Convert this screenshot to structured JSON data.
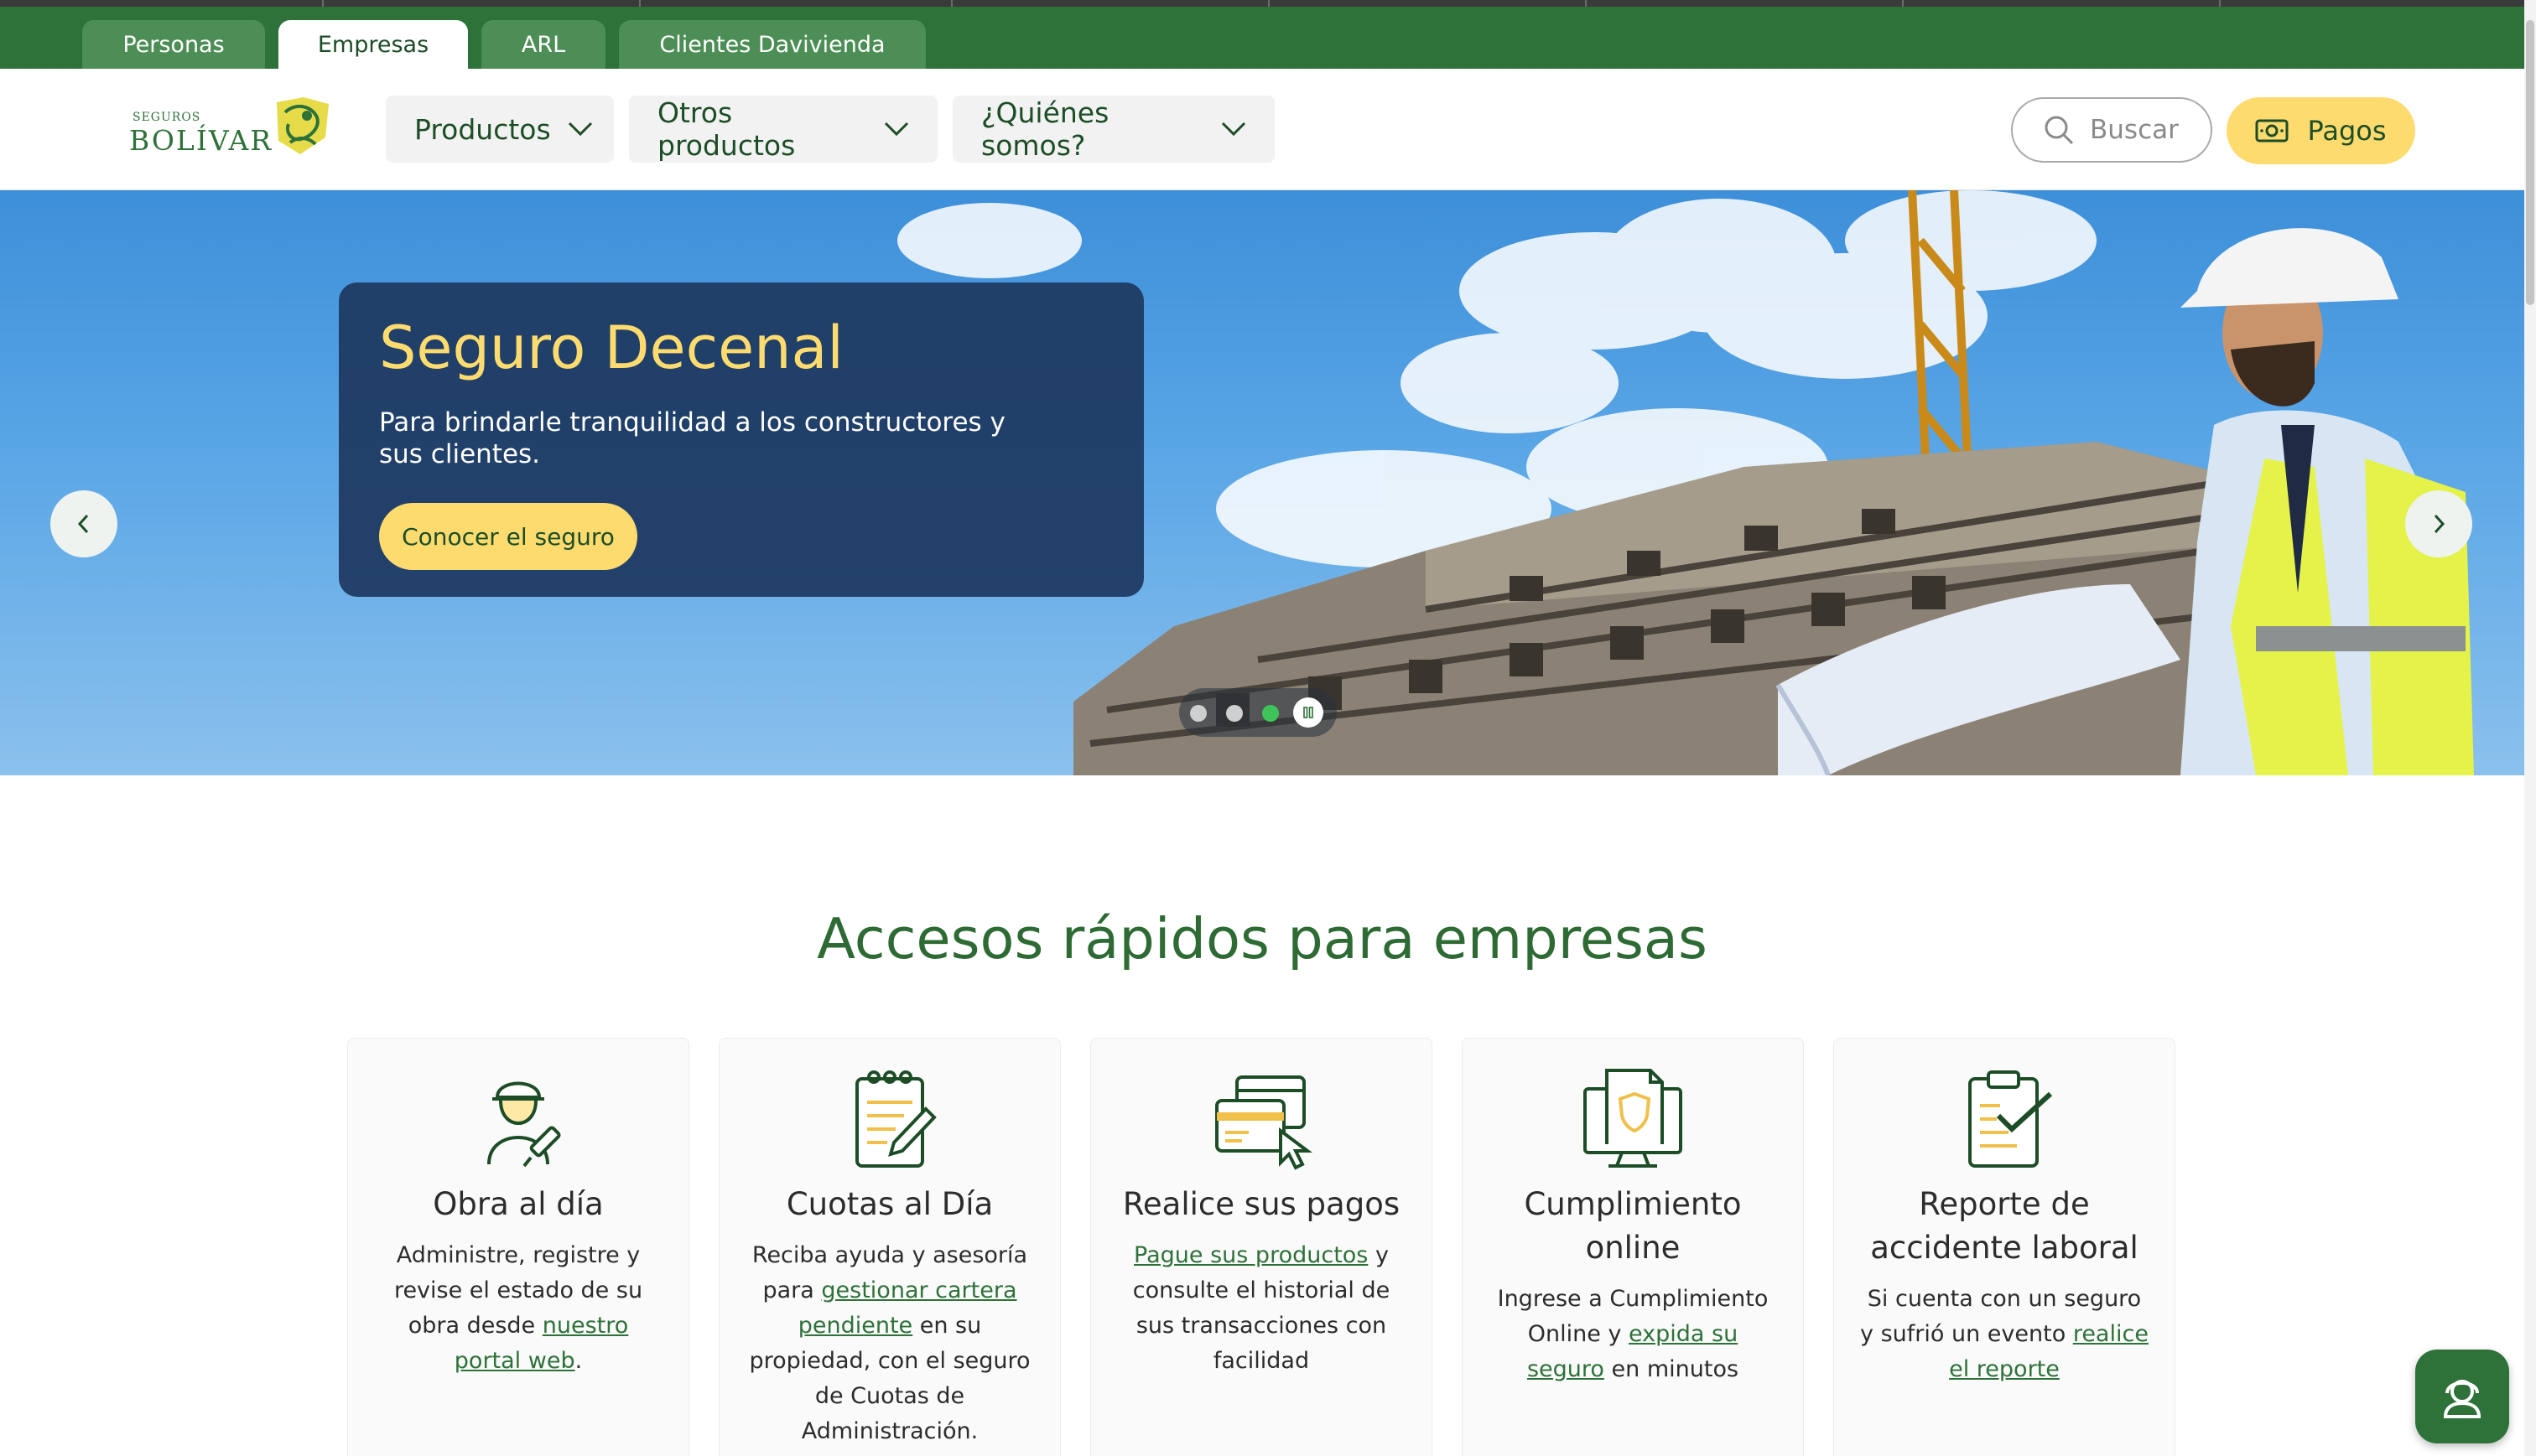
{
  "segments": {
    "tabs": [
      {
        "label": "Personas",
        "active": false
      },
      {
        "label": "Empresas",
        "active": true
      },
      {
        "label": "ARL",
        "active": false
      },
      {
        "label": "Clientes Davivienda",
        "active": false
      }
    ]
  },
  "header": {
    "logo": {
      "small_text": "SEGUROS",
      "big_text": "BOLÍVAR"
    },
    "nav": [
      {
        "label": "Productos"
      },
      {
        "label": "Otros productos"
      },
      {
        "label": "¿Quiénes somos?"
      }
    ],
    "search_placeholder": "Buscar",
    "pay_label": "Pagos"
  },
  "hero": {
    "title": "Seguro Decenal",
    "description": "Para brindarle tranquilidad a los constructores y sus clientes.",
    "cta_label": "Conocer el seguro",
    "slides_total": 3,
    "active_slide": 3
  },
  "quick_access": {
    "title": "Accesos rápidos para empresas",
    "cards": [
      {
        "title": "Obra al día",
        "icon": "construction-worker-icon",
        "parts": [
          {
            "t": "Administre, registre y revise el estado de su obra desde "
          },
          {
            "t": "nuestro portal web",
            "link": true
          },
          {
            "t": "."
          }
        ]
      },
      {
        "title": "Cuotas al Día",
        "icon": "notepad-pencil-icon",
        "parts": [
          {
            "t": "Reciba ayuda y asesoría para "
          },
          {
            "t": "gestionar cartera pendiente",
            "link": true
          },
          {
            "t": " en su propiedad, con el seguro de Cuotas de Administración."
          }
        ]
      },
      {
        "title": "Realice sus pagos",
        "icon": "payment-cards-icon",
        "parts": [
          {
            "t": "Pague sus productos",
            "link": true
          },
          {
            "t": " y consulte el historial de sus transacciones con facilidad"
          }
        ]
      },
      {
        "title": "Cumplimiento online",
        "icon": "monitor-shield-icon",
        "parts": [
          {
            "t": "Ingrese a Cumplimiento Online y "
          },
          {
            "t": "expida su seguro",
            "link": true
          },
          {
            "t": " en minutos"
          }
        ]
      },
      {
        "title": "Reporte de accidente laboral",
        "icon": "clipboard-check-icon",
        "parts": [
          {
            "t": "Si cuenta con un seguro y sufrió un evento "
          },
          {
            "t": "realice el reporte",
            "link": true
          }
        ]
      }
    ]
  },
  "colors": {
    "brand_green": "#2e7139",
    "accent_yellow": "#fddb6f",
    "hero_card": "#1d3860"
  }
}
